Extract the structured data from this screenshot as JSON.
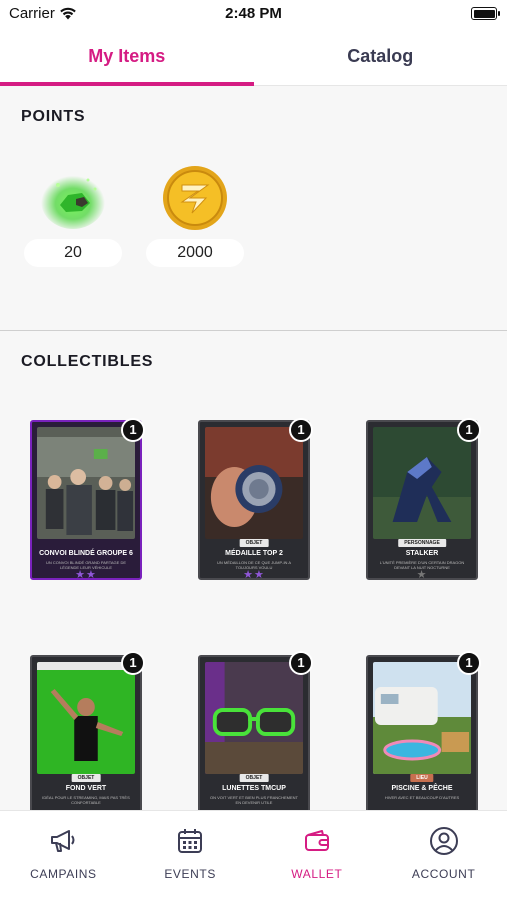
{
  "status_bar": {
    "carrier": "Carrier",
    "time": "2:48 PM"
  },
  "tabs": [
    {
      "label": "My Items",
      "active": true
    },
    {
      "label": "Catalog",
      "active": false
    }
  ],
  "points": {
    "title": "POINTS",
    "items": [
      {
        "icon": "green-gem-icon",
        "value": "20"
      },
      {
        "icon": "gold-coin-icon",
        "value": "2000"
      }
    ]
  },
  "collectibles": {
    "title": "COLLECTIBLES",
    "items": [
      {
        "name": "CONVOI BLINDÉ GROUPE 6",
        "tag": "",
        "description": "UN CONVOI BLINDÉ GRAND PARTAGE DE LÉGENDE LEUR VÉHICULE",
        "quantity": "1",
        "rarity_stars": 2,
        "frame": "purple"
      },
      {
        "name": "MÉDAILLE TOP 2",
        "tag": "OBJET",
        "description": "UN MÉDAILLON DE CE QUE JUMP-IN A TOUJOURS VOULU",
        "quantity": "1",
        "rarity_stars": 2,
        "frame": "dark"
      },
      {
        "name": "STALKER",
        "tag": "PERSONNAGE",
        "description": "L'UNITÉ PREMIÈRE D'UN CERTAIN DRAGON DEVANT LA NUIT NOCTURNE",
        "quantity": "1",
        "rarity_stars": 1,
        "frame": "dark"
      },
      {
        "name": "FOND VERT",
        "tag": "OBJET",
        "description": "IDÉAL POUR LE STREAMING, MAIS PAS TRÈS CONFORTABLE",
        "quantity": "1",
        "rarity_stars": 0,
        "frame": "dark"
      },
      {
        "name": "LUNETTES TMCUP",
        "tag": "OBJET",
        "description": "ON VOIT VERT ET BIEN PLUS FRANCHEMENT EN DEVENIR UTILE",
        "quantity": "1",
        "rarity_stars": 0,
        "frame": "dark"
      },
      {
        "name": "PISCINE & PÊCHE",
        "tag": "LIEU",
        "description": "HIVER AVEC ET BEAUCOUP D'AUTRES",
        "quantity": "1",
        "rarity_stars": 0,
        "frame": "dark"
      }
    ]
  },
  "bottom_nav": [
    {
      "label": "CAMPAINS",
      "icon": "megaphone-icon",
      "active": false
    },
    {
      "label": "EVENTS",
      "icon": "calendar-icon",
      "active": false
    },
    {
      "label": "WALLET",
      "icon": "wallet-icon",
      "active": true
    },
    {
      "label": "ACCOUNT",
      "icon": "account-icon",
      "active": false
    }
  ],
  "colors": {
    "accent": "#d51c83",
    "text_dark": "#1b1b24",
    "nav_text": "#3c3d55",
    "rarity_purple": "#9057d8"
  }
}
